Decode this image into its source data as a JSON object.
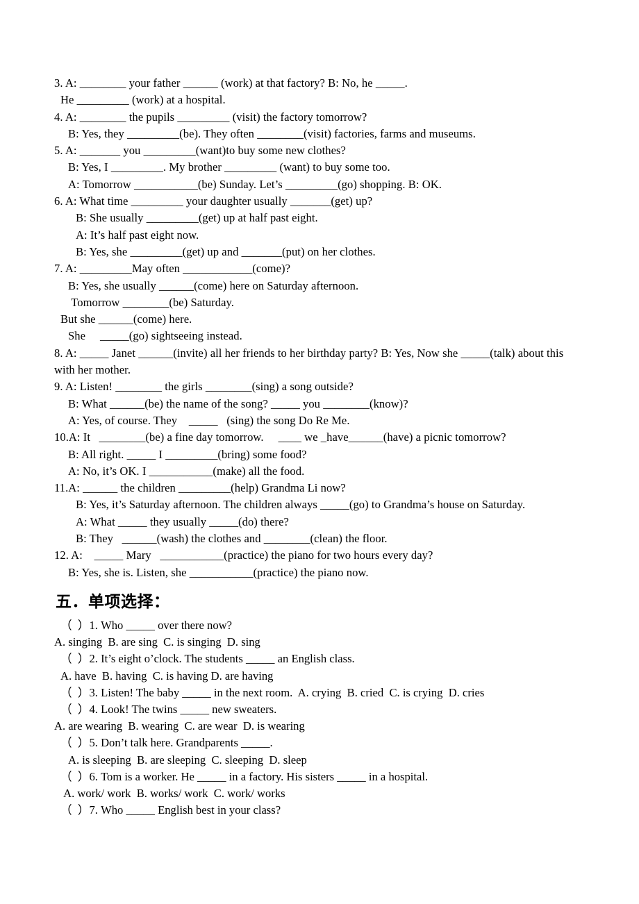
{
  "document": {
    "type": "english-grammar-worksheet",
    "language_note": "Chinese-language English exercise sheet",
    "background_color": "#ffffff",
    "text_color": "#000000"
  },
  "fill_in_blanks": {
    "lines": [
      {
        "indent": 0,
        "text": "3. A: ________ your father ______ (work) at that factory? B: No, he _____."
      },
      {
        "indent": 1,
        "text": "He _________ (work) at a hospital."
      },
      {
        "indent": 0,
        "text": "4. A: ________ the pupils _________ (visit) the factory tomorrow?"
      },
      {
        "indent": 2,
        "text": "B: Yes, they _________(be). They often ________(visit) factories, farms and museums."
      },
      {
        "indent": 0,
        "text": "5. A: _______ you _________(want)to buy some new clothes?"
      },
      {
        "indent": 2,
        "text": "B: Yes, I _________. My brother _________ (want) to buy some too."
      },
      {
        "indent": 2,
        "text": "A: Tomorrow ___________(be) Sunday. Let’s _________(go) shopping. B: OK."
      },
      {
        "indent": 0,
        "text": "6. A: What time _________ your daughter usually _______(get) up?"
      },
      {
        "indent": 3,
        "text": "B: She usually _________(get) up at half past eight."
      },
      {
        "indent": 3,
        "text": "A: It’s half past eight now."
      },
      {
        "indent": 3,
        "text": "B: Yes, she _________(get) up and _______(put) on her clothes."
      },
      {
        "indent": 0,
        "text": "7. A: _________May often ____________(come)?"
      },
      {
        "indent": 2,
        "text": "B: Yes, she usually ______(come) here on Saturday afternoon."
      },
      {
        "indent": 2,
        "text": " Tomorrow ________(be) Saturday."
      },
      {
        "indent": 1,
        "text": "But she ______(come) here."
      },
      {
        "indent": 2,
        "text": "She     _____(go) sightseeing instead."
      },
      {
        "indent": 0,
        "justified": true,
        "text": "8. A: _____ Janet ______(invite) all her friends to her birthday party? B: Yes, Now she _____(talk) about this"
      },
      {
        "indent": 0,
        "text": "with her mother."
      },
      {
        "indent": 0,
        "text": "9. A: Listen! ________ the girls ________(sing) a song outside?"
      },
      {
        "indent": 2,
        "text": "B: What ______(be) the name of the song? _____ you ________(know)?"
      },
      {
        "indent": 2,
        "text": "A: Yes, of course. They    _____   (sing) the song Do Re Me."
      },
      {
        "indent": 0,
        "text": "10.A: It   ________(be) a fine day tomorrow.     ____ we _have______(have) a picnic tomorrow?"
      },
      {
        "indent": 2,
        "text": "B: All right. _____ I _________(bring) some food?"
      },
      {
        "indent": 2,
        "text": "A: No, it’s OK. I ___________(make) all the food."
      },
      {
        "indent": 0,
        "text": "11.A: ______ the children _________(help) Grandma Li now?"
      },
      {
        "indent": 3,
        "text": "B: Yes, it’s Saturday afternoon. The children always _____(go) to Grandma’s house on Saturday."
      },
      {
        "indent": 3,
        "text": "A: What _____ they usually _____(do) there?"
      },
      {
        "indent": 3,
        "text": "B: They   ______(wash) the clothes and ________(clean) the floor."
      },
      {
        "indent": 0,
        "text": "12. A:    _____ Mary   ___________(practice) the piano for two hours every day?"
      },
      {
        "indent": 2,
        "text": "B: Yes, she is. Listen, she ___________(practice) the piano now."
      }
    ]
  },
  "section_five": {
    "heading": "五．单项选择：",
    "lines": [
      {
        "indent": 1,
        "text": "（  ）1. Who _____ over there now?"
      },
      {
        "indent": 0,
        "text": "A. singing  B. are sing  C. is singing  D. sing"
      },
      {
        "indent": 1,
        "text": "（  ）2. It’s eight o’clock. The students _____ an English class."
      },
      {
        "indent": 1,
        "text": "A. have  B. having  C. is having D. are having"
      },
      {
        "indent": 1,
        "text": "（  ）3. Listen! The baby _____ in the next room.  A. crying  B. cried  C. is crying  D. cries"
      },
      {
        "indent": 1,
        "text": "（  ）4. Look! The twins _____ new sweaters."
      },
      {
        "indent": 0,
        "text": "A. are wearing  B. wearing  C. are wear  D. is wearing"
      },
      {
        "indent": 1,
        "text": "（  ）5. Don’t talk here. Grandparents _____."
      },
      {
        "indent": 2,
        "text": "A. is sleeping  B. are sleeping  C. sleeping  D. sleep"
      },
      {
        "indent": 1,
        "text": "（  ）6. Tom is a worker. He _____ in a factory. His sisters _____ in a hospital."
      },
      {
        "indent": 1,
        "text": " A. work/ work  B. works/ work  C. work/ works"
      },
      {
        "indent": 1,
        "text": "（  ）7. Who _____ English best in your class?"
      }
    ]
  }
}
